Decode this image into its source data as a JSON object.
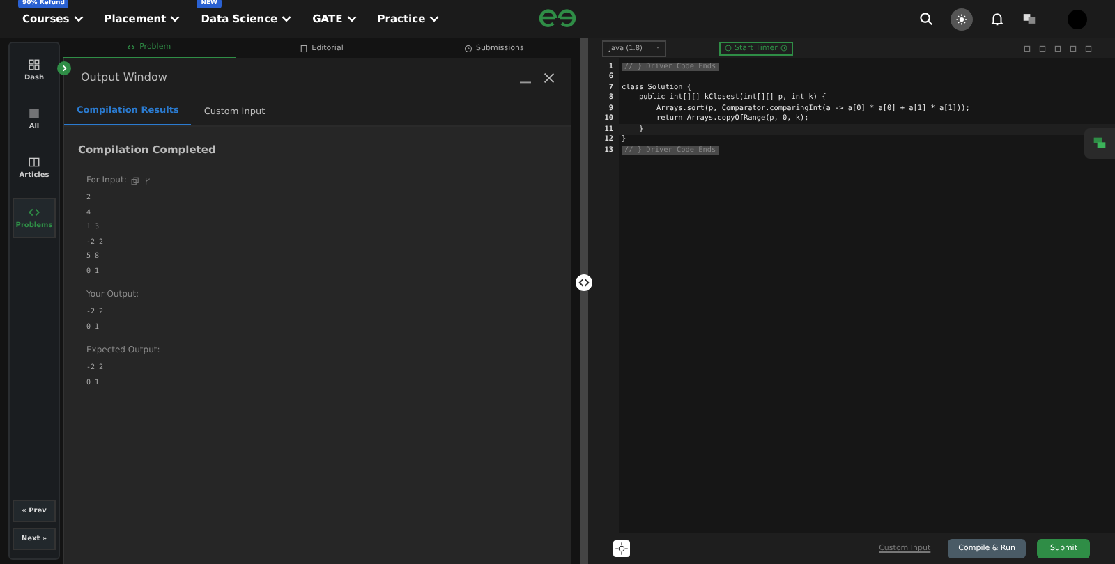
{
  "nav": {
    "items": [
      {
        "label": "Courses",
        "badge": "90% Refund"
      },
      {
        "label": "Placement"
      },
      {
        "label": "Data Science",
        "badge": "NEW"
      },
      {
        "label": "GATE"
      },
      {
        "label": "Practice"
      }
    ]
  },
  "sidebar": {
    "items": [
      {
        "label": "Dash",
        "selected": false
      },
      {
        "label": "All",
        "selected": false
      },
      {
        "label": "Articles",
        "selected": false
      },
      {
        "label": "Problems",
        "selected": true
      }
    ],
    "prev": "« Prev",
    "next": "Next »"
  },
  "problem_tabs": [
    {
      "label": "Problem",
      "selected": true
    },
    {
      "label": "Editorial",
      "selected": false
    },
    {
      "label": "Submissions",
      "selected": false
    }
  ],
  "output_window": {
    "title": "Output Window",
    "tabs": [
      {
        "label": "Compilation Results",
        "selected": true
      },
      {
        "label": "Custom Input",
        "selected": false
      }
    ],
    "status": "Compilation Completed",
    "sections": [
      {
        "label": "For Input:",
        "lines": [
          "2",
          "4",
          "1 3",
          "-2 2",
          "5 8",
          "0 1"
        ]
      },
      {
        "label": "Your Output:",
        "lines": [
          "-2 2",
          "0 1"
        ]
      },
      {
        "label": "Expected Output:",
        "lines": [
          "-2 2",
          "0 1"
        ]
      }
    ]
  },
  "editor": {
    "language": "Java (1.8)",
    "timer": "Start Timer",
    "lines": [
      {
        "number": "1",
        "kind": "fold",
        "text": "// } Driver Code Ends"
      },
      {
        "number": "6",
        "kind": "blank"
      },
      {
        "number": "7",
        "kind": "code",
        "text": "class Solution {"
      },
      {
        "number": "8",
        "kind": "code",
        "text": "    public int[][] kClosest(int[][] p, int k) {"
      },
      {
        "number": "9",
        "kind": "code",
        "text": "        Arrays.sort(p, Comparator.comparingInt(a -> a[0] * a[0] + a[1] * a[1]));"
      },
      {
        "number": "10",
        "kind": "code",
        "text": "        return Arrays.copyOfRange(p, 0, k);"
      },
      {
        "number": "11",
        "kind": "code",
        "text": "    }"
      },
      {
        "number": "12",
        "kind": "code",
        "text": "}"
      },
      {
        "number": "13",
        "kind": "fold",
        "text": "// } Driver Code Ends"
      }
    ],
    "custom_input": "Custom Input",
    "compile": "Compile & Run",
    "submit": "Submit"
  }
}
